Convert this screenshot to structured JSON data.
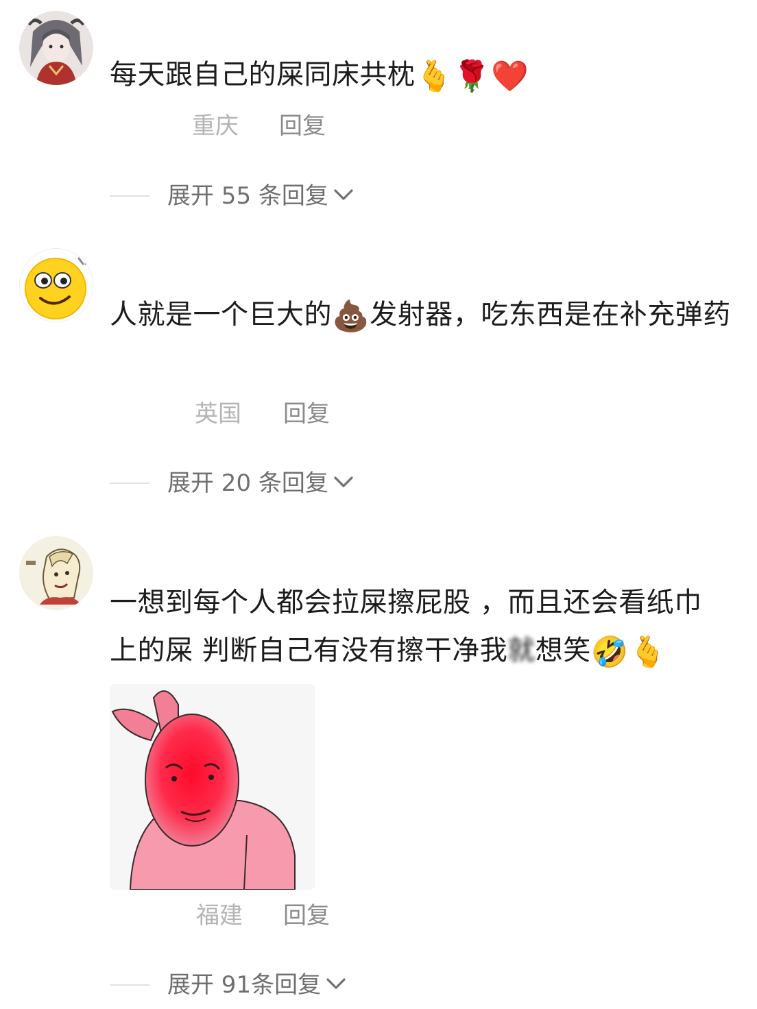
{
  "comments": [
    {
      "text_parts": [
        "每天跟自己的屎同床共枕"
      ],
      "emojis": [
        "🫰",
        "🌹",
        "❤️"
      ],
      "location": "重庆",
      "reply_label": "回复",
      "expand_label": "展开 55 条回复"
    },
    {
      "text_before": "人就是一个巨大的",
      "emoji_mid": "💩",
      "text_after": "发射器，吃东西是在补充弹药",
      "location": "英国",
      "reply_label": "回复",
      "expand_label": "展开 20 条回复"
    },
    {
      "text_line1": "一想到每个人都会拉屎擦屁股 ，而且还会看纸巾",
      "text_line2_a": "上的屎 判断自己有没有擦干净我",
      "text_line2_blur": "就",
      "text_line2_b": "想笑",
      "emojis": [
        "🤣",
        "🫰"
      ],
      "location": "福建",
      "reply_label": "回复",
      "expand_label": "展开 91条回复"
    }
  ],
  "icons": {
    "chevron": "chevron-down-icon"
  },
  "colors": {
    "location": "#b4b4b4",
    "reply": "#8a8a8a",
    "expand": "#6f6f6f",
    "sticker_face": "#ff1a3a",
    "sticker_body": "#f28fa6"
  }
}
